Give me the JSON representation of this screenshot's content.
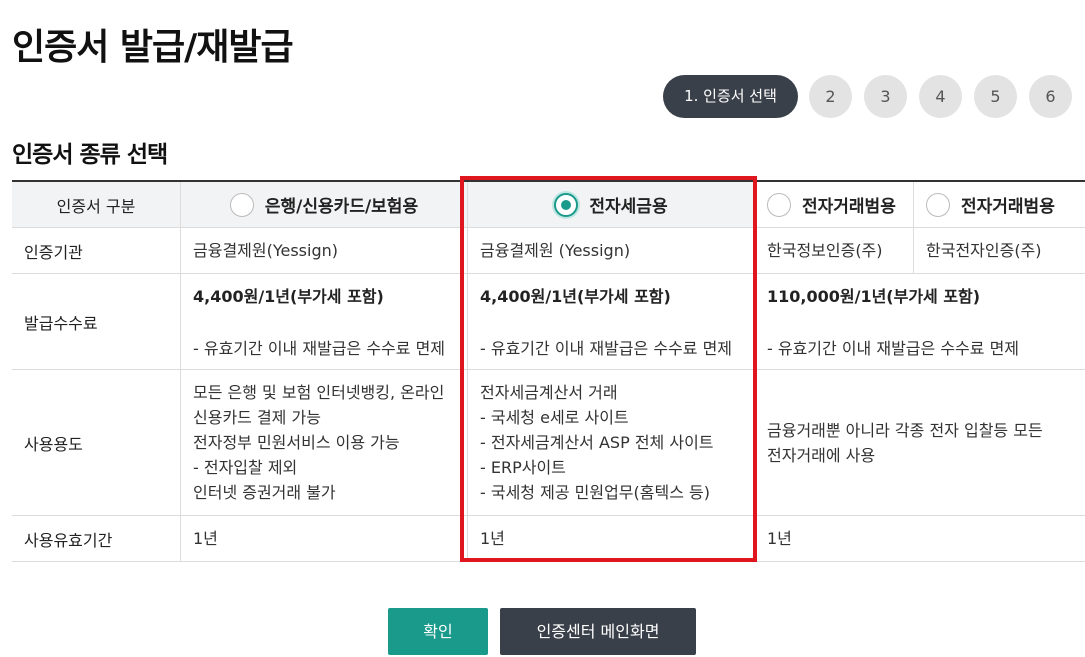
{
  "page_title": "인증서 발급/재발급",
  "steps": {
    "current_label": "1. 인증서 선택",
    "others": [
      "2",
      "3",
      "4",
      "5",
      "6"
    ]
  },
  "section_title": "인증서 종류 선택",
  "table": {
    "header_label": "인증서 구분",
    "options": [
      "은행/신용카드/보험용",
      "전자세금용",
      "전자거래범용",
      "전자거래범용"
    ],
    "selected_option": "전자세금용",
    "rows": {
      "issuer": {
        "label": "인증기관",
        "values": [
          "금융결제원(Yessign)",
          "금융결제원 (Yessign)",
          "한국정보인증(주)",
          "한국전자인증(주)"
        ]
      },
      "fee": {
        "label": "발급수수료",
        "col1": {
          "price": "4,400원/1년(부가세 포함)",
          "note": "- 유효기간 이내 재발급은 수수료 면제"
        },
        "col2": {
          "price": "4,400원/1년(부가세 포함)",
          "note": "- 유효기간 이내 재발급은 수수료 면제"
        },
        "col3": {
          "price": "110,000원/1년(부가세 포함)",
          "note": "- 유효기간 이내 재발급은 수수료 면제"
        }
      },
      "usage": {
        "label": "사용용도",
        "col1": [
          "모든 은행 및 보험 인터넷뱅킹, 온라인",
          "신용카드 결제 가능",
          "전자정부 민원서비스 이용 가능",
          "- 전자입찰 제외",
          "인터넷 증권거래 불가"
        ],
        "col2": [
          "전자세금계산서 거래",
          "- 국세청 e세로 사이트",
          "- 전자세금계산서 ASP 전체 사이트",
          "- ERP사이트",
          "- 국세청 제공 민원업무(홈텍스 등)"
        ],
        "col3": [
          "금융거래뿐 아니라 각종 전자 입찰등 모든",
          "전자거래에 사용"
        ]
      },
      "validity": {
        "label": "사용유효기간",
        "values": [
          "1년",
          "1년",
          "1년"
        ]
      }
    }
  },
  "buttons": {
    "confirm": "확인",
    "main": "인증센터 메인화면"
  },
  "colors": {
    "accent": "#1a9a8b",
    "dark": "#3a4049",
    "highlight": "#e0161e"
  }
}
